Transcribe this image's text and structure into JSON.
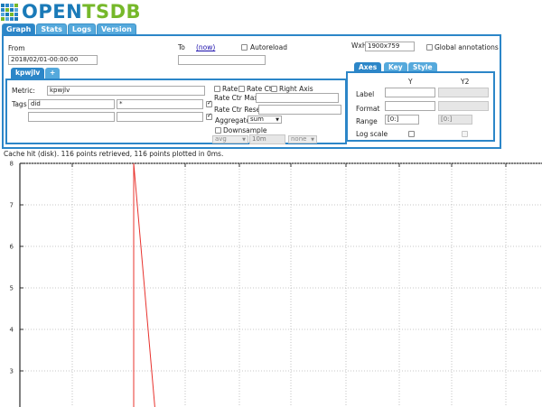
{
  "header": {
    "logo_part1": "OPEN",
    "logo_part2": "TSDB",
    "logo_colors": [
      "#1a7ab8",
      "#76b82a"
    ]
  },
  "main_tabs": [
    {
      "label": "Graph",
      "active": true
    },
    {
      "label": "Stats",
      "active": false
    },
    {
      "label": "Logs",
      "active": false
    },
    {
      "label": "Version",
      "active": false
    }
  ],
  "time": {
    "from_label": "From",
    "from_value": "2018/02/01-00:00:00",
    "to_label": "To",
    "to_now_link": "(now)",
    "to_value": "",
    "autoreload_label": "Autoreload",
    "autoreload_checked": false
  },
  "size": {
    "label": "WxH",
    "value": "1900x759",
    "global_annotations_label": "Global annotations",
    "global_annotations_checked": false
  },
  "query_tabs": [
    {
      "label": "kpwjlv"
    },
    {
      "label": "+"
    }
  ],
  "metric": {
    "metric_label": "Metric:",
    "metric_value": "kpwjlv",
    "tags_label": "Tags",
    "tags": [
      {
        "key": "did",
        "value": "*",
        "group_by": true
      },
      {
        "key": "",
        "value": "",
        "group_by": true
      }
    ],
    "rate_label": "Rate",
    "rate_checked": false,
    "rate_ctr_label": "Rate Ctr",
    "rate_ctr_checked": false,
    "right_axis_label": "Right Axis",
    "right_axis_checked": false,
    "rate_ctr_max_label": "Rate Ctr Max:",
    "rate_ctr_max_value": "",
    "rate_ctr_reset_label": "Rate Ctr Reset:",
    "rate_ctr_reset_value": "",
    "aggregator_label": "Aggregator:",
    "aggregator_value": "sum",
    "downsample_label": "Downsample",
    "downsample_checked": false,
    "downsample_func": "avg",
    "downsample_interval": "10m",
    "downsample_fill": "none"
  },
  "axes_panel": {
    "tabs": [
      {
        "label": "Axes",
        "active": true
      },
      {
        "label": "Key",
        "active": false
      },
      {
        "label": "Style",
        "active": false
      }
    ],
    "col_y": "Y",
    "col_y2": "Y2",
    "label_row": "Label",
    "format_row": "Format",
    "range_row": "Range",
    "range_y": "[0:]",
    "range_y2": "[0:]",
    "log_scale_row": "Log scale"
  },
  "status": {
    "text": "Cache hit (disk). 116 points retrieved, 116 points plotted in 0ms."
  },
  "chart_data": {
    "type": "line",
    "title": "",
    "xlabel": "",
    "ylabel": "",
    "ylim": [
      2.1,
      8
    ],
    "yticks": [
      "8",
      "7",
      "6",
      "5",
      "4",
      "3"
    ],
    "grid": true,
    "series": [
      {
        "x": [
          0,
          0.49
        ],
        "y": [
          8.0,
          2.1
        ],
        "color": "#e8332e"
      }
    ]
  }
}
